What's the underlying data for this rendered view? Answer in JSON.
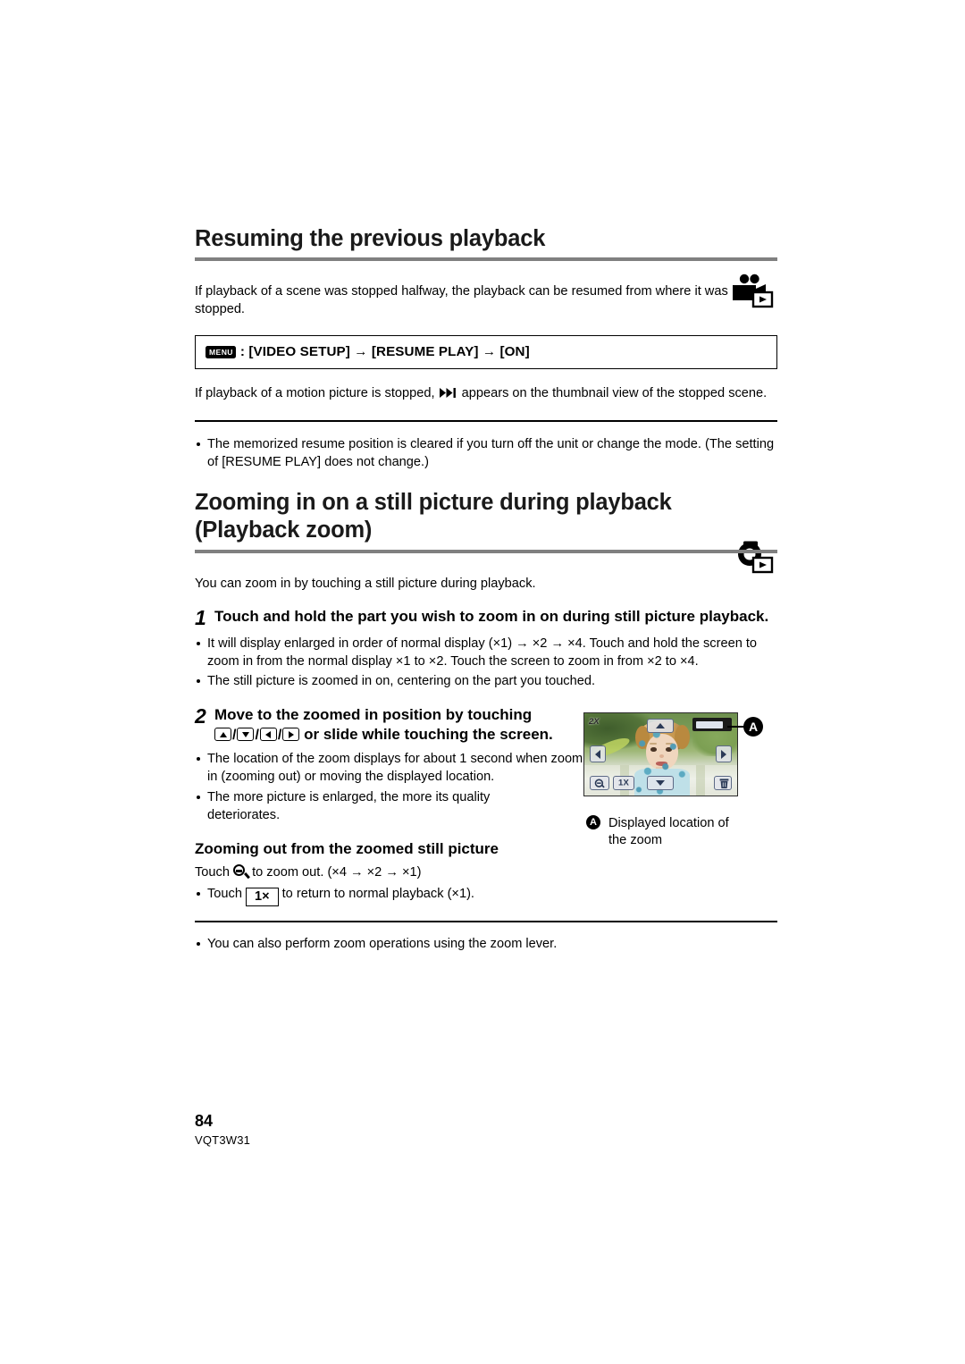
{
  "document": {
    "page_number": "84",
    "doc_code": "VQT3W31"
  },
  "section1": {
    "heading": "Resuming the previous playback",
    "mode_icon": "video-playback-mode-icon",
    "intro": "If playback of a scene was stopped halfway, the playback can be resumed from where it was stopped.",
    "menu_path": {
      "menu_chip": "MENU",
      "text": ": [VIDEO SETUP] → [RESUME PLAY] → [ON]"
    },
    "note_before_icon": "If playback of a motion picture is stopped,",
    "note_icon": "fast-forward-icon",
    "note_after_icon": "appears on the thumbnail view of the stopped scene.",
    "bullets": [
      "The memorized resume position is cleared if you turn off the unit or change the mode. (The setting of [RESUME PLAY] does not change.)"
    ]
  },
  "section2": {
    "heading_line1": "Zooming in on a still picture during playback",
    "heading_line2": "(Playback zoom)",
    "mode_icon": "still-picture-playback-mode-icon",
    "intro": "You can zoom in by touching a still picture during playback.",
    "step1": {
      "number": "1",
      "text": "Touch and hold the part you wish to zoom in on during still picture playback.",
      "bullets": [
        "It will display enlarged in order of normal display (×1) → ×2 → ×4. Touch and hold the screen to zoom in from the normal display ×1 to ×2. Touch the screen to zoom in from ×2 to ×4.",
        "The still picture is zoomed in on, centering on the part you touched."
      ]
    },
    "step2": {
      "number": "2",
      "text_before_keys": "Move to the zoomed in position by touching",
      "keys": [
        "up-arrow",
        "down-arrow",
        "left-arrow",
        "right-arrow"
      ],
      "text_after_keys": "or slide while touching the screen.",
      "bullets": [
        "The location of the zoom displays for about 1 second when zooming in (zooming out) or moving the displayed location.",
        "The more picture is enlarged, the more its quality deteriorates."
      ]
    },
    "subsection": {
      "heading": "Zooming out from the zoomed still picture",
      "touch_line_prefix": "Touch",
      "touch_line_icon": "zoom-out-magnifier-icon",
      "touch_line_suffix": "to zoom out. (×4 → ×2 → ×1)",
      "bullet_prefix": "Touch",
      "bullet_button": "1×",
      "bullet_suffix": "to return to normal playback (×1)."
    },
    "footer_bullets": [
      "You can also perform zoom operations using the zoom lever."
    ]
  },
  "illustration": {
    "callout_letter": "A",
    "caption_line1": "Displayed location of",
    "caption_line2": "the zoom",
    "lcd": {
      "zoom_level": "2X",
      "normal_button": "1X",
      "zoom_out_button": "zoom-out-magnifier-icon",
      "delete_button": "trash-icon",
      "direction_buttons": [
        "up-arrow",
        "down-arrow",
        "left-arrow",
        "right-arrow"
      ],
      "position_indicator": "zoom-position-bar"
    }
  },
  "colors": {
    "rule_gray": "#808080",
    "text_black": "#000000",
    "page_background": "#ffffff"
  }
}
